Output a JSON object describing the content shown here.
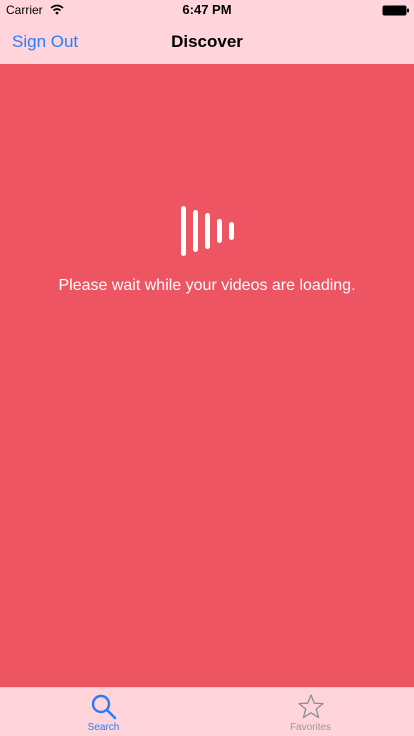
{
  "status_bar": {
    "carrier": "Carrier",
    "time": "6:47 PM"
  },
  "nav": {
    "left_button": "Sign Out",
    "title": "Discover"
  },
  "content": {
    "loader_icon": "audio-waveform-icon",
    "loading_message": "Please wait while your videos are loading."
  },
  "tabs": [
    {
      "label": "Search",
      "icon": "search-icon",
      "selected": true
    },
    {
      "label": "Favorites",
      "icon": "star-icon",
      "selected": false
    }
  ],
  "colors": {
    "background": "#ee5563",
    "bars": "#ffd5db",
    "accent": "#2b7cf6",
    "inactive": "#999999"
  }
}
